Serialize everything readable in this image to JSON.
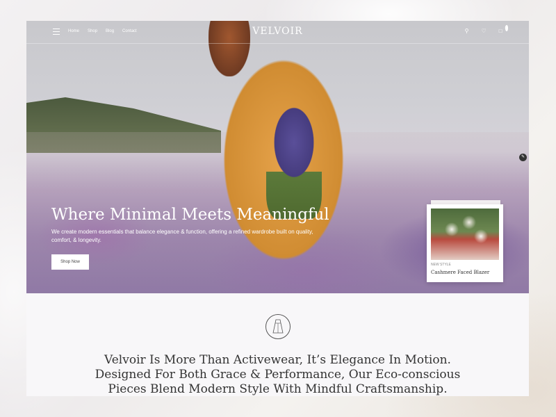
{
  "brand": {
    "logo": "VELVOIR"
  },
  "nav": {
    "links": [
      {
        "label": "Home"
      },
      {
        "label": "Shop"
      },
      {
        "label": "Blog"
      },
      {
        "label": "Contact"
      }
    ],
    "icons": [
      "menu-icon",
      "search-icon",
      "heart-icon",
      "bag-icon"
    ],
    "cart_count": "0"
  },
  "hero": {
    "title": "Where Minimal Meets Meaningful",
    "subtitle": "We create modern essentials that balance elegance & function, offering a refined wardrobe built on quality, comfort, & longevity.",
    "cta": "Shop Now"
  },
  "product_card": {
    "tag": "NEW STYLE",
    "name": "Cashmere Faced  Blazer"
  },
  "about": {
    "line1": "Velvoir Is More Than Activewear, It’s Elegance In Motion.",
    "line2": "Designed For Both Grace & Performance, Our Eco-conscious",
    "line3": "Pieces Blend Modern Style With Mindful Craftsmanship."
  },
  "colors": {
    "accent": "#d08c32",
    "text_dark": "#333333",
    "white": "#ffffff"
  }
}
